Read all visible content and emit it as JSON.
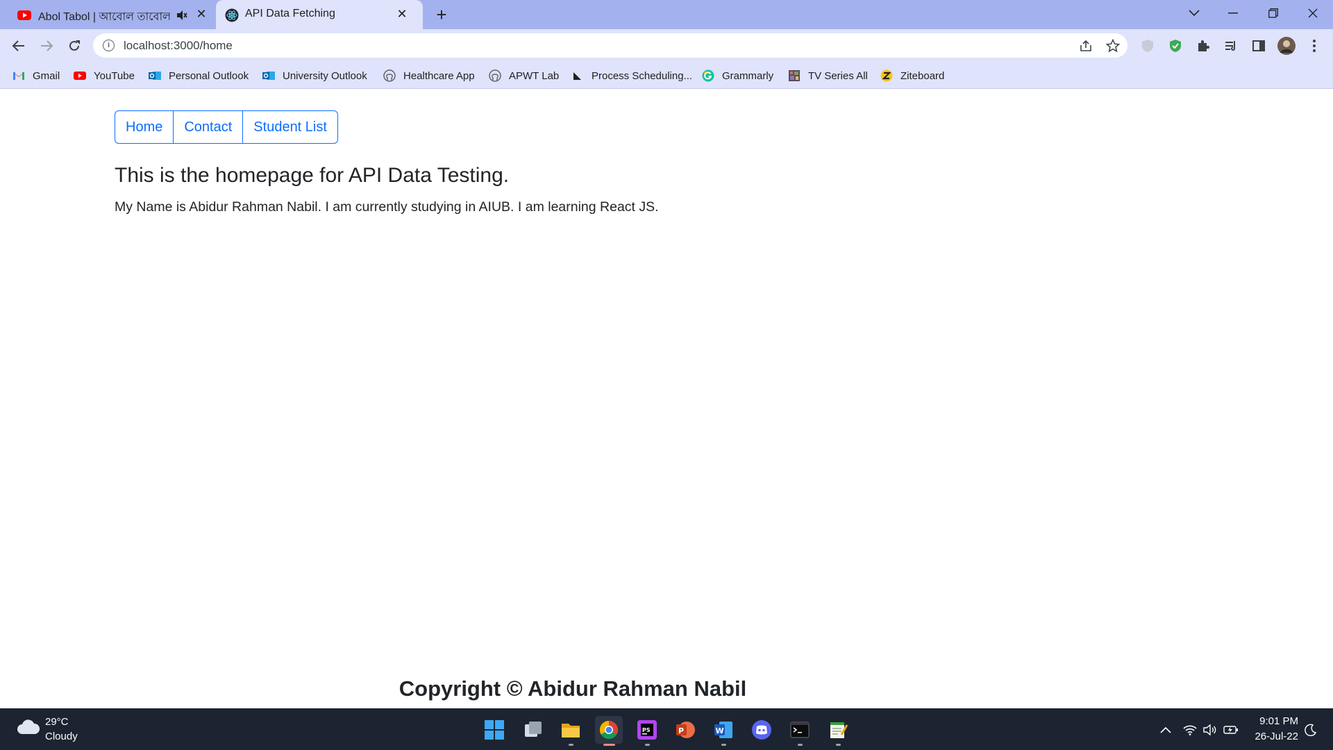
{
  "browser": {
    "tabs": [
      {
        "title": "Abol Tabol | আবোল তাবোল |",
        "icon": "youtube-icon",
        "muted": true
      },
      {
        "title": "API Data Fetching",
        "icon": "react-icon",
        "active": true
      }
    ],
    "address": {
      "url": "localhost:3000/home"
    },
    "bookmarks": [
      {
        "label": "Gmail",
        "icon": "gmail-icon"
      },
      {
        "label": "YouTube",
        "icon": "youtube-icon"
      },
      {
        "label": "Personal Outlook",
        "icon": "outlook-icon"
      },
      {
        "label": "University Outlook",
        "icon": "outlook-icon"
      },
      {
        "label": "Healthcare App",
        "icon": "github-icon"
      },
      {
        "label": "APWT Lab",
        "icon": "github-icon"
      },
      {
        "label": "Process Scheduling...",
        "icon": "flag-icon"
      },
      {
        "label": "Grammarly",
        "icon": "grammarly-icon"
      },
      {
        "label": "TV Series All",
        "icon": "film-icon"
      },
      {
        "label": "Ziteboard",
        "icon": "ziteboard-icon"
      }
    ]
  },
  "page": {
    "nav": [
      "Home",
      "Contact",
      "Student List"
    ],
    "heading": "This is the homepage for API Data Testing.",
    "paragraph": "My Name is Abidur Rahman Nabil. I am currently studying in AIUB. I am learning React JS.",
    "footer": "Copyright © Abidur Rahman Nabil"
  },
  "taskbar": {
    "weather": {
      "temp": "29°C",
      "desc": "Cloudy"
    },
    "clock": {
      "time": "9:01 PM",
      "date": "26-Jul-22"
    },
    "apps": [
      "windows-start-icon",
      "task-view-icon",
      "file-explorer-icon",
      "chrome-icon",
      "phpstorm-icon",
      "powerpoint-icon",
      "word-icon",
      "discord-icon",
      "terminal-icon",
      "notepad-icon"
    ]
  },
  "colors": {
    "tabstrip": "#a3b2ee",
    "toolbar": "#dfe3fb",
    "link": "#0d6efd",
    "text": "#212529",
    "taskbar": "#1c2431"
  }
}
